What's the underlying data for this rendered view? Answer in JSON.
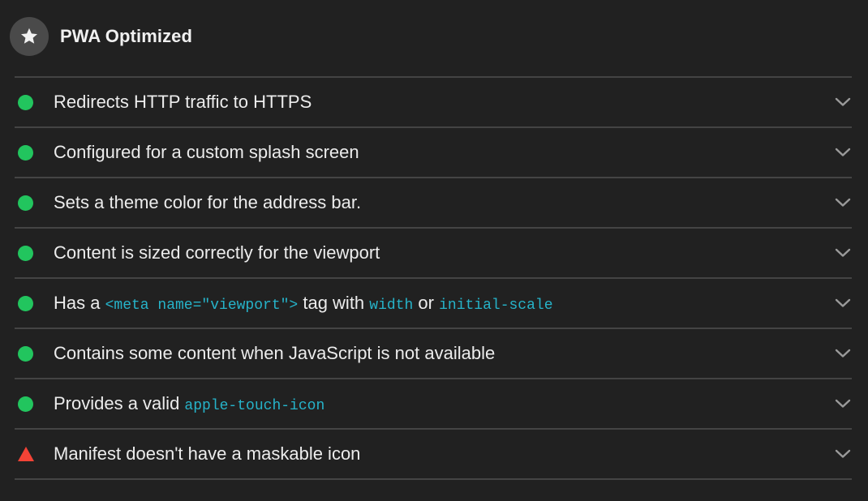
{
  "section": {
    "title": "PWA Optimized",
    "icon": "star-icon"
  },
  "colors": {
    "pass": "#22c55e",
    "fail": "#f44336",
    "code": "#26b3c9"
  },
  "audits": [
    {
      "status": "pass",
      "parts": [
        {
          "text": "Redirects HTTP traffic to HTTPS"
        }
      ]
    },
    {
      "status": "pass",
      "parts": [
        {
          "text": "Configured for a custom splash screen"
        }
      ]
    },
    {
      "status": "pass",
      "parts": [
        {
          "text": "Sets a theme color for the address bar."
        }
      ]
    },
    {
      "status": "pass",
      "parts": [
        {
          "text": "Content is sized correctly for the viewport"
        }
      ]
    },
    {
      "status": "pass",
      "parts": [
        {
          "text": "Has a "
        },
        {
          "code": "<meta name=\"viewport\">"
        },
        {
          "text": " tag with "
        },
        {
          "code": "width"
        },
        {
          "text": " or "
        },
        {
          "code": "initial-scale"
        }
      ]
    },
    {
      "status": "pass",
      "parts": [
        {
          "text": "Contains some content when JavaScript is not available"
        }
      ]
    },
    {
      "status": "pass",
      "parts": [
        {
          "text": "Provides a valid "
        },
        {
          "code": "apple-touch-icon"
        }
      ]
    },
    {
      "status": "fail",
      "parts": [
        {
          "text": "Manifest doesn't have a maskable icon"
        }
      ]
    }
  ]
}
